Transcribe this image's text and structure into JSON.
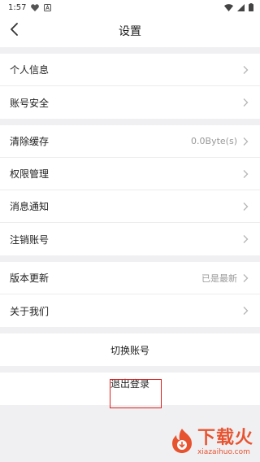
{
  "status_bar": {
    "time": "1:57",
    "icons": [
      "heart-icon",
      "notification-a-icon",
      "wifi-icon",
      "signal-icon",
      "battery-icon"
    ]
  },
  "header": {
    "title": "设置",
    "back_icon": "chevron-left-icon"
  },
  "groups": [
    {
      "items": [
        {
          "label": "个人信息",
          "value": ""
        },
        {
          "label": "账号安全",
          "value": ""
        }
      ]
    },
    {
      "items": [
        {
          "label": "清除缓存",
          "value": "0.0Byte(s)"
        },
        {
          "label": "权限管理",
          "value": ""
        },
        {
          "label": "消息通知",
          "value": ""
        },
        {
          "label": "注销账号",
          "value": ""
        }
      ]
    },
    {
      "items": [
        {
          "label": "版本更新",
          "value": "已是最新"
        },
        {
          "label": "关于我们",
          "value": ""
        }
      ]
    }
  ],
  "switch_account": {
    "label": "切换账号"
  },
  "logout": {
    "label": "退出登录"
  },
  "watermark": {
    "text": "下载火",
    "url": "xiazaihuo.com"
  },
  "colors": {
    "background": "#f0f0f3",
    "highlight_border": "#e02020",
    "watermark": "#e8461f"
  }
}
